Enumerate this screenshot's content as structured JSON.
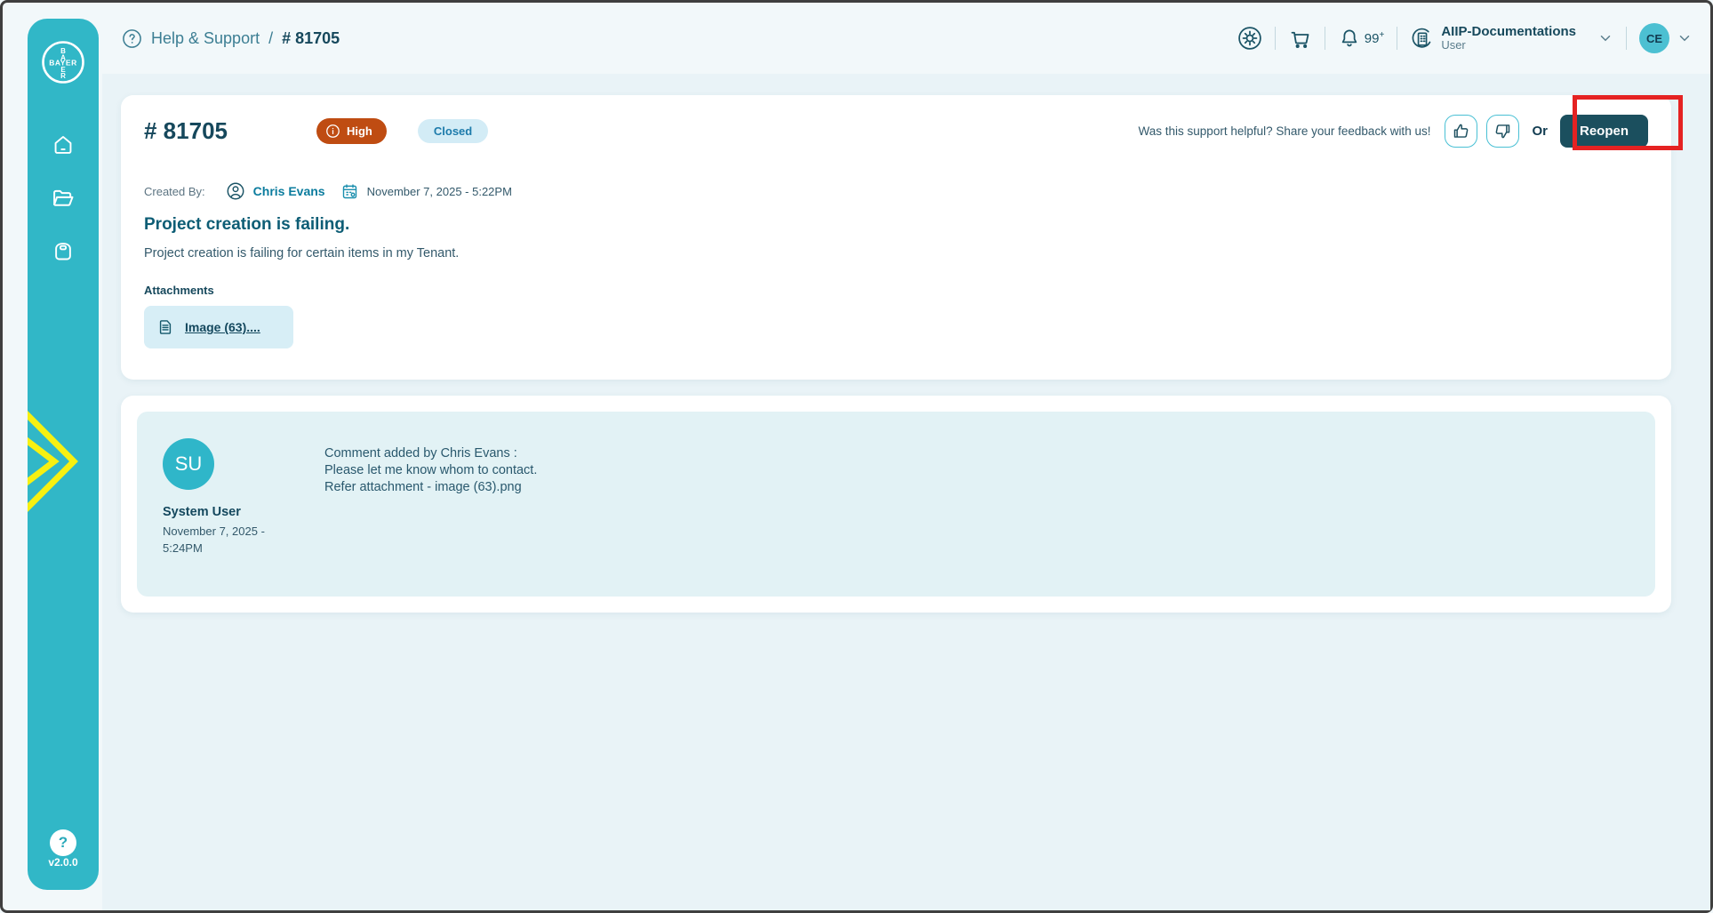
{
  "app": {
    "version": "v2.0.0",
    "logo_text": "BAYER",
    "logo_vertical": [
      "B",
      "A",
      "E",
      "R"
    ]
  },
  "breadcrumb": {
    "section": "Help & Support",
    "separator": "/",
    "ticket": "# 81705"
  },
  "header": {
    "notification_count": "99",
    "notification_plus": "+",
    "org_name": "AIIP-Documentations",
    "org_role": "User",
    "avatar_initials": "CE"
  },
  "ticket": {
    "id": "# 81705",
    "priority": "High",
    "status": "Closed",
    "feedback_prompt": "Was this support helpful? Share your feedback with us!",
    "or_label": "Or",
    "reopen_label": "Reopen",
    "created_by_label": "Created By:",
    "created_by": "Chris Evans",
    "created_at": "November 7, 2025 - 5:22PM",
    "title": "Project creation is failing.",
    "description": "Project creation is failing for certain items in my Tenant.",
    "attachments_label": "Attachments",
    "attachment_name": "Image (63)...."
  },
  "comment": {
    "author_initials": "SU",
    "author_name": "System User",
    "date_line1": "November 7, 2025 -",
    "date_line2": "5:24PM",
    "lines": [
      "Comment added by Chris Evans :",
      "Please let me know whom to contact.",
      "Refer attachment - image (63).png"
    ]
  },
  "icons": {
    "question_mark": "?",
    "names": [
      "bayer-logo",
      "home-icon",
      "folder-icon",
      "bag-icon",
      "chevron-decoration",
      "help-icon",
      "gear-icon",
      "cart-icon",
      "bell-icon",
      "org-building-icon",
      "chevron-down-icon",
      "user-circle-icon",
      "calendar-icon",
      "file-icon",
      "thumbs-up-icon",
      "thumbs-down-icon",
      "info-icon"
    ]
  },
  "colors": {
    "sidebar_teal": "#31b7c7",
    "accent_dark": "#1b4f5e",
    "priority_high_bg": "#bf4c12",
    "status_closed_bg": "#d3ecf6",
    "status_closed_text": "#1d7bab",
    "annotation_red": "#e52222",
    "chevron_yellow": "#f7f011",
    "link_teal": "#0b7c9e"
  }
}
